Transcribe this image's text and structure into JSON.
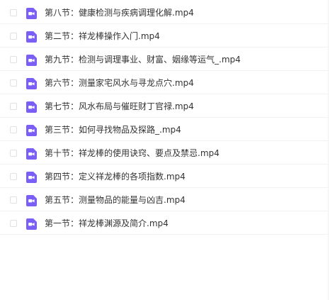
{
  "files": [
    {
      "name": "第八节：健康检测与疾病调理化解.mp4",
      "icon": "video-file-icon"
    },
    {
      "name": "第二节：祥龙棒操作入门.mp4",
      "icon": "video-file-icon"
    },
    {
      "name": "第九节：检测与调理事业、财富、姻缘等运气_.mp4",
      "icon": "video-file-icon"
    },
    {
      "name": "第六节：测量家宅风水与寻龙点穴.mp4",
      "icon": "video-file-icon"
    },
    {
      "name": "第七节：风水布局与催旺财丁官禄.mp4",
      "icon": "video-file-icon"
    },
    {
      "name": "第三节：如何寻找物品及探路_.mp4",
      "icon": "video-file-icon"
    },
    {
      "name": "第十节：祥龙棒的使用诀窍、要点及禁忌.mp4",
      "icon": "video-file-icon"
    },
    {
      "name": "第四节：定义祥龙棒的各项指数.mp4",
      "icon": "video-file-icon"
    },
    {
      "name": "第五节：测量物品的能量与凶吉.mp4",
      "icon": "video-file-icon"
    },
    {
      "name": "第一节：祥龙棒渊源及简介.mp4",
      "icon": "video-file-icon"
    }
  ],
  "colors": {
    "icon_bg": "#7b5ef6",
    "icon_fg": "#ffffff",
    "row_divider": "#f1f2f4",
    "text": "#333333"
  }
}
